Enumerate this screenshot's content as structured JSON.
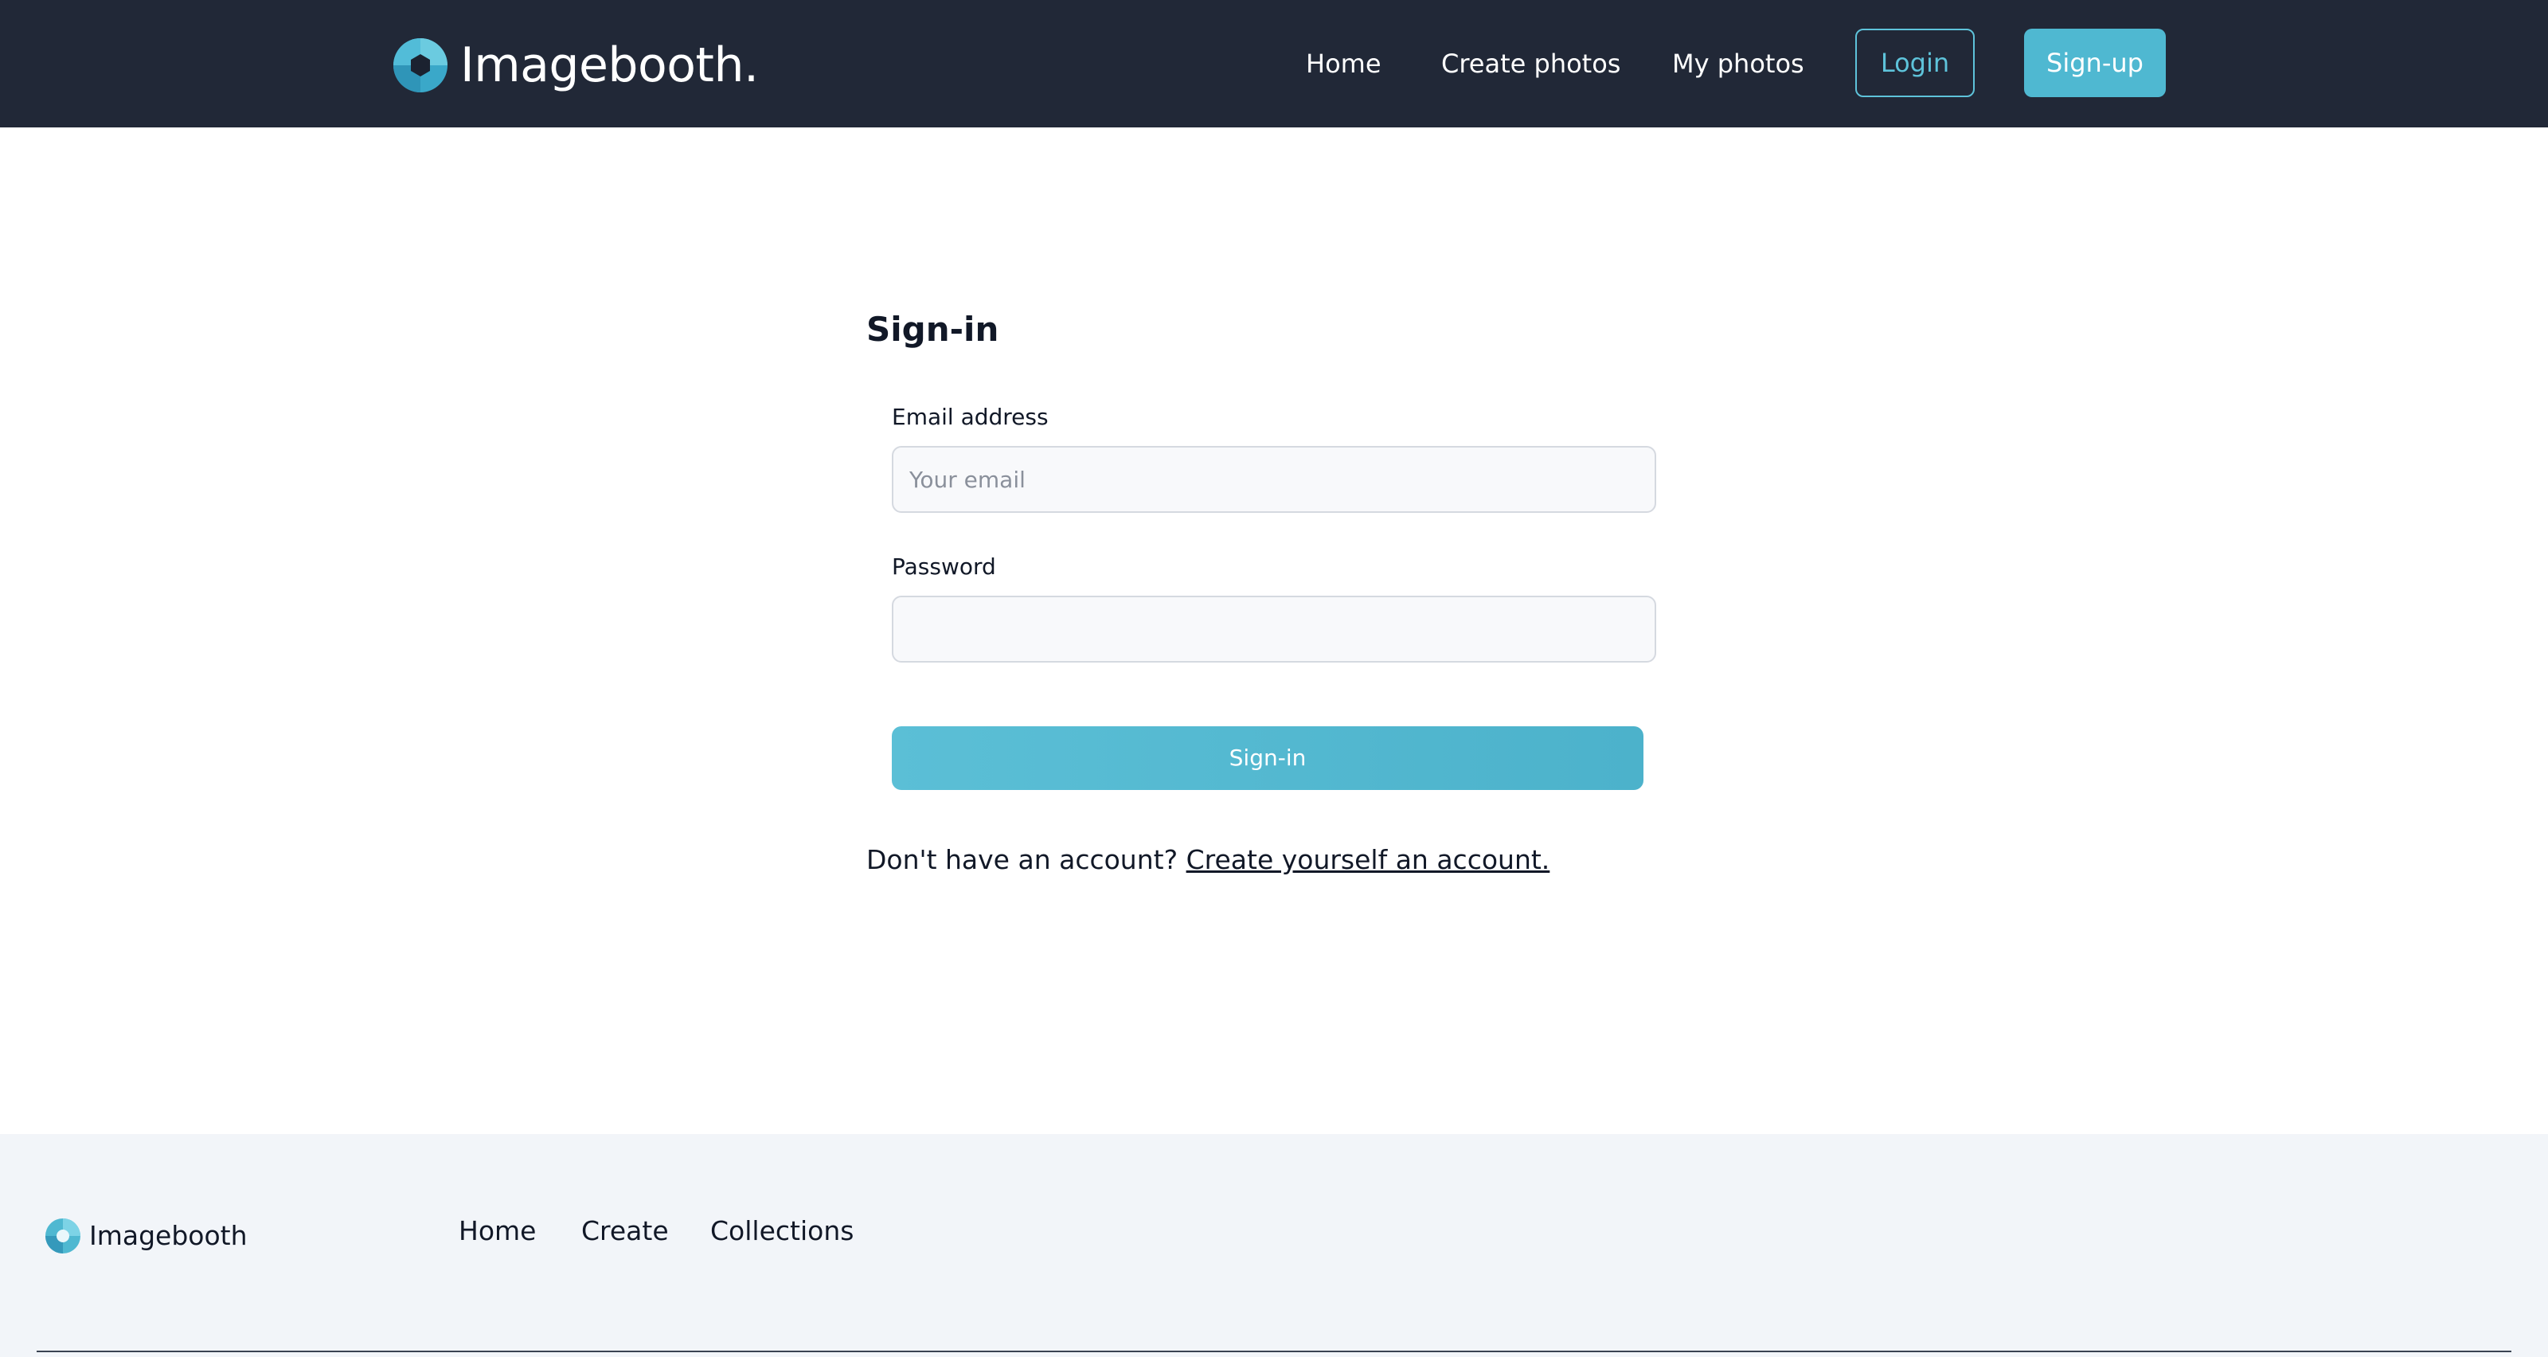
{
  "header": {
    "brand": "Imagebooth.",
    "nav": {
      "home": "Home",
      "create_photos": "Create photos",
      "my_photos": "My photos"
    },
    "login_label": "Login",
    "signup_label": "Sign-up"
  },
  "form": {
    "title": "Sign-in",
    "email_label": "Email address",
    "email_placeholder": "Your email",
    "email_value": "",
    "password_label": "Password",
    "password_value": "",
    "submit_label": "Sign-in",
    "prompt_text": "Don't have an account?",
    "prompt_link": "Create yourself an account."
  },
  "footer": {
    "brand": "Imagebooth",
    "links": {
      "home": "Home",
      "create": "Create",
      "collections": "Collections"
    }
  },
  "colors": {
    "header_bg": "#212837",
    "accent": "#4fb8d1",
    "footer_bg": "#f2f5f9"
  },
  "icons": {
    "brand_logo": "aperture-logo-icon",
    "footer_logo": "ring-logo-icon"
  }
}
